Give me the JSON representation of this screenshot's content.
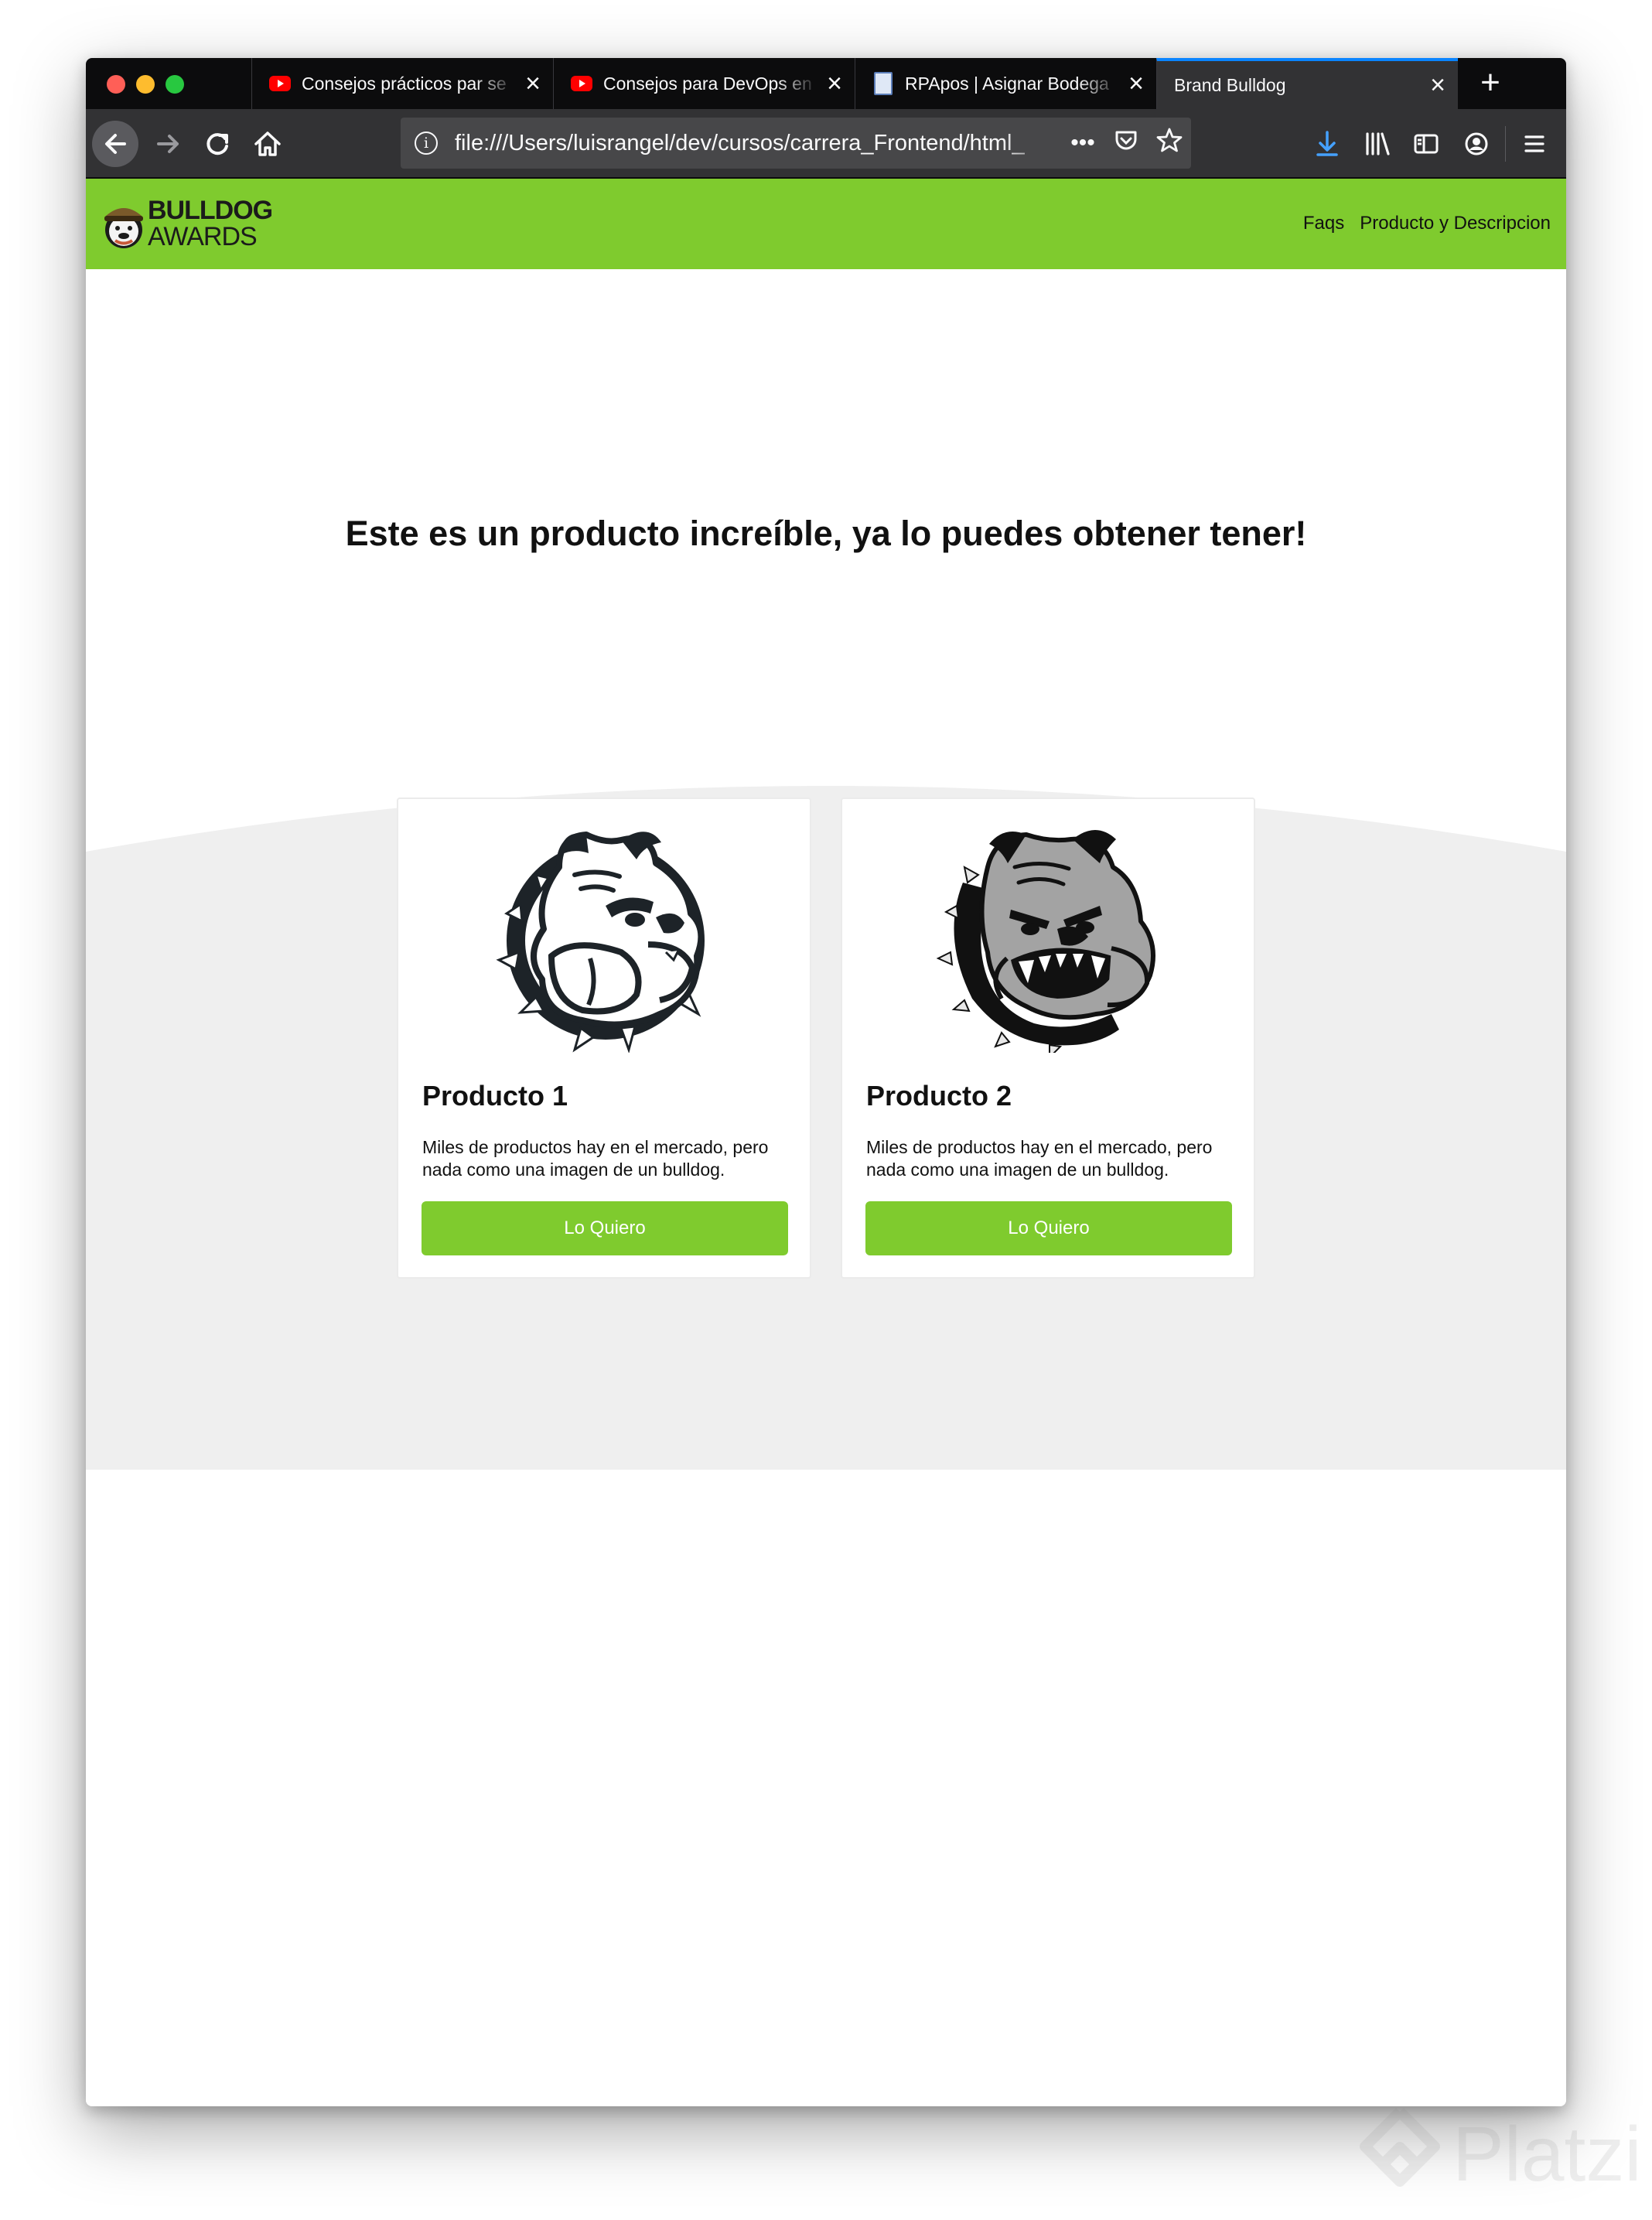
{
  "browser": {
    "tabs": [
      {
        "label": "Consejos prácticos par se",
        "favicon": "youtube-icon",
        "active": false
      },
      {
        "label": "Consejos para DevOps en",
        "favicon": "youtube-icon",
        "active": false
      },
      {
        "label": "RPApos | Asignar Bodega",
        "favicon": "document-icon",
        "active": false
      },
      {
        "label": "Brand Bulldog",
        "favicon": "",
        "active": true
      }
    ],
    "url": "file:///Users/luisrangel/dev/cursos/carrera_Frontend/html_",
    "colors": {
      "tabstrip": "#0c0c0d",
      "toolbar": "#323234",
      "active_tab_accent": "#0a84ff"
    }
  },
  "site": {
    "logo": {
      "line1": "BULLDOG",
      "line2": "AWARDS"
    },
    "nav": [
      "Faqs",
      "Producto y Descripcion"
    ],
    "hero_title": "Este es un producto increíble, ya lo puedes obtener tener!",
    "products": [
      {
        "title": "Producto 1",
        "description": "Miles de productos hay en el mercado, pero nada como una imagen de un bulldog.",
        "button": "Lo Quiero",
        "image": "bulldog-black-white-icon"
      },
      {
        "title": "Producto 2",
        "description": "Miles de productos hay en el mercado, pero nada como una imagen de un bulldog.",
        "button": "Lo Quiero",
        "image": "bulldog-grey-icon"
      }
    ],
    "colors": {
      "brand_green": "#7fcb2e",
      "section_grey": "#efefef"
    }
  },
  "watermark": "Platzi"
}
